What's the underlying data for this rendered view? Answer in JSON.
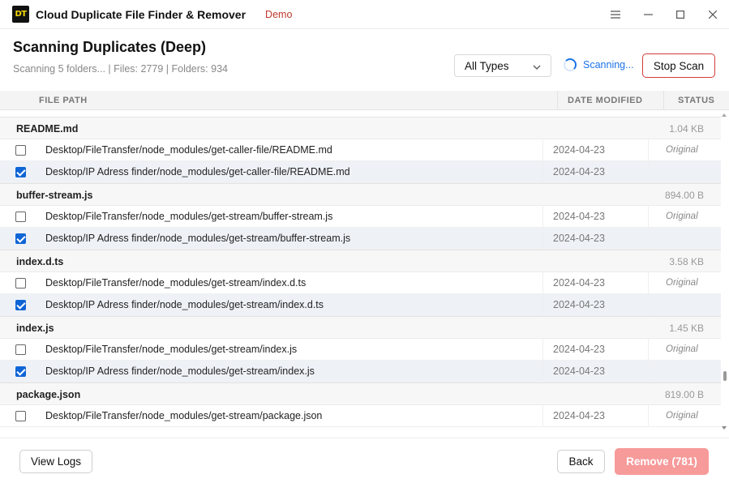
{
  "app": {
    "logo_text": "DT",
    "title": "Cloud Duplicate File Finder & Remover",
    "demo_label": "Demo"
  },
  "header": {
    "title": "Scanning Duplicates (Deep)",
    "scan_info": "Scanning 5 folders... | Files: 2779 | Folders: 934",
    "type_filter": "All Types",
    "scan_status": "Scanning...",
    "stop_label": "Stop Scan"
  },
  "table": {
    "columns": {
      "path": "FILE PATH",
      "date": "DATE MODIFIED",
      "status": "STATUS"
    },
    "groups": [
      {
        "name": "README.md",
        "size": "1.04 KB",
        "files": [
          {
            "path": "Desktop/FileTransfer/node_modules/get-caller-file/README.md",
            "date": "2024-04-23",
            "status": "Original",
            "checked": false
          },
          {
            "path": "Desktop/IP Adress finder/node_modules/get-caller-file/README.md",
            "date": "2024-04-23",
            "status": "",
            "checked": true
          }
        ]
      },
      {
        "name": "buffer-stream.js",
        "size": "894.00 B",
        "files": [
          {
            "path": "Desktop/FileTransfer/node_modules/get-stream/buffer-stream.js",
            "date": "2024-04-23",
            "status": "Original",
            "checked": false
          },
          {
            "path": "Desktop/IP Adress finder/node_modules/get-stream/buffer-stream.js",
            "date": "2024-04-23",
            "status": "",
            "checked": true
          }
        ]
      },
      {
        "name": "index.d.ts",
        "size": "3.58 KB",
        "files": [
          {
            "path": "Desktop/FileTransfer/node_modules/get-stream/index.d.ts",
            "date": "2024-04-23",
            "status": "Original",
            "checked": false
          },
          {
            "path": "Desktop/IP Adress finder/node_modules/get-stream/index.d.ts",
            "date": "2024-04-23",
            "status": "",
            "checked": true
          }
        ]
      },
      {
        "name": "index.js",
        "size": "1.45 KB",
        "files": [
          {
            "path": "Desktop/FileTransfer/node_modules/get-stream/index.js",
            "date": "2024-04-23",
            "status": "Original",
            "checked": false
          },
          {
            "path": "Desktop/IP Adress finder/node_modules/get-stream/index.js",
            "date": "2024-04-23",
            "status": "",
            "checked": true
          }
        ]
      },
      {
        "name": "package.json",
        "size": "819.00 B",
        "files": [
          {
            "path": "Desktop/FileTransfer/node_modules/get-stream/package.json",
            "date": "2024-04-23",
            "status": "Original",
            "checked": false
          }
        ]
      }
    ]
  },
  "footer": {
    "logs_label": "View Logs",
    "back_label": "Back",
    "remove_label": "Remove (781)"
  },
  "colors": {
    "accent": "#1a73e8",
    "danger": "#d33b3b",
    "remove_bg": "#f79a9a",
    "demo": "#c0392b"
  },
  "icons": {
    "menu": "hamburger-icon",
    "minimize": "minimize-icon",
    "maximize": "maximize-icon",
    "close": "close-icon",
    "dropdown": "chevron-down-icon",
    "spinner": "spinner-icon"
  }
}
